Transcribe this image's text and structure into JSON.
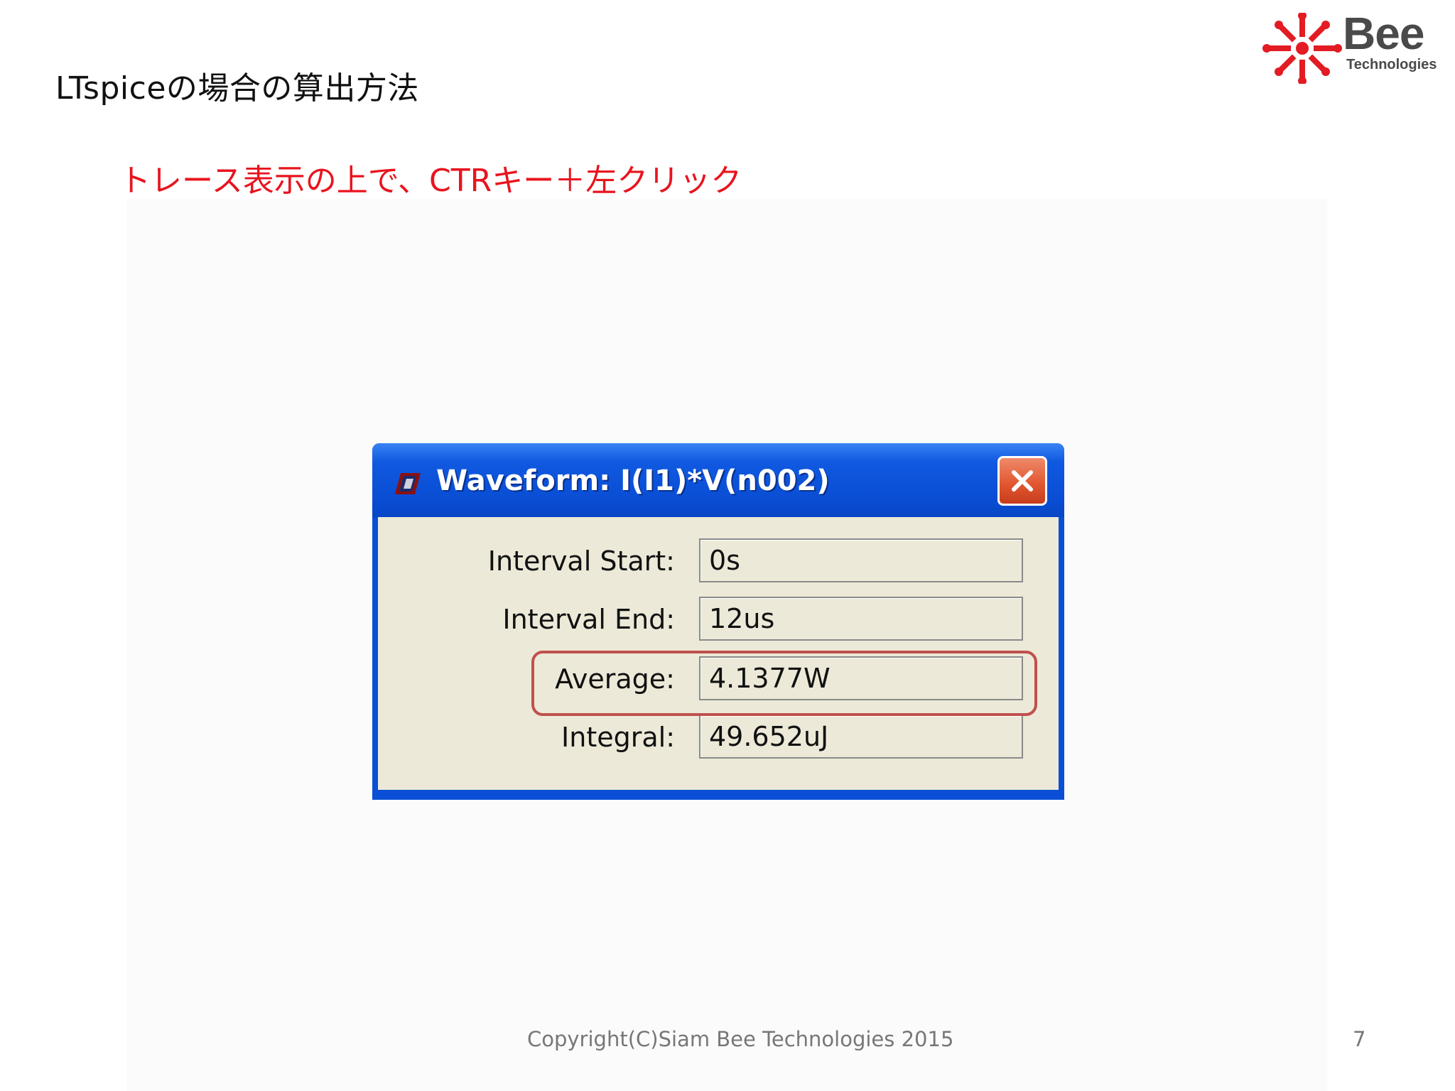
{
  "slide": {
    "title": "LTspiceの場合の算出方法",
    "instruction": "トレース表示の上で、CTRキー＋左クリック",
    "logo": {
      "name": "Bee",
      "sub": "Technologies",
      "accent": "#e31b23"
    },
    "footer": "Copyright(C)Siam Bee Technologies 2015",
    "page_number": "7"
  },
  "dialog": {
    "title": "Waveform: I(I1)*V(n002)",
    "close_icon": "close-icon",
    "rows": [
      {
        "label": "Interval Start:",
        "value": "0s"
      },
      {
        "label": "Interval End:",
        "value": "12us"
      },
      {
        "label": "Average:",
        "value": "4.1377W"
      },
      {
        "label": "Integral:",
        "value": "49.652uJ"
      }
    ],
    "highlight_color": "#c0504d"
  }
}
